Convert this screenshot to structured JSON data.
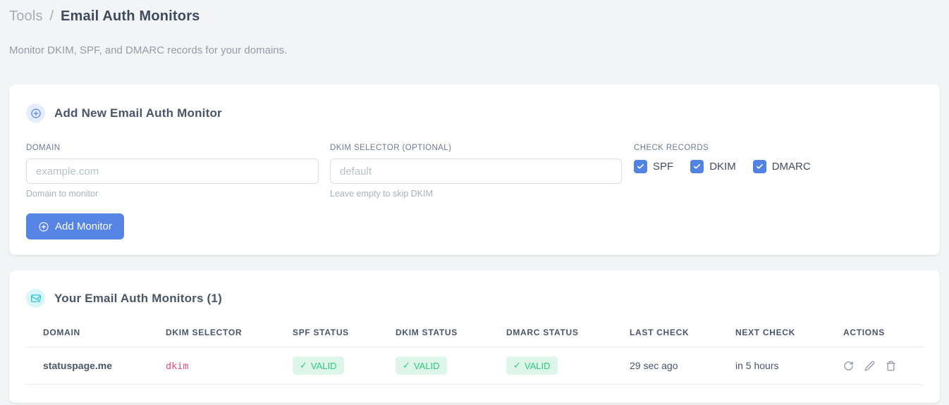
{
  "header": {
    "breadcrumb": {
      "section": "Tools",
      "separator": "/",
      "current": "Email Auth Monitors"
    },
    "subtitle": "Monitor DKIM, SPF, and DMARC records for your domains."
  },
  "add_card": {
    "title": "Add New Email Auth Monitor",
    "fields": {
      "domain": {
        "label": "DOMAIN",
        "placeholder": "example.com",
        "value": "",
        "helper": "Domain to monitor"
      },
      "dkim_selector": {
        "label": "DKIM SELECTOR (OPTIONAL)",
        "placeholder": "default",
        "value": "",
        "helper": "Leave empty to skip DKIM"
      }
    },
    "check_records": {
      "label": "CHECK RECORDS",
      "options": [
        {
          "label": "SPF",
          "checked": true
        },
        {
          "label": "DKIM",
          "checked": true
        },
        {
          "label": "DMARC",
          "checked": true
        }
      ]
    },
    "submit_button": "Add Monitor"
  },
  "monitors_card": {
    "title": "Your Email Auth Monitors (1)",
    "table": {
      "headers": [
        "DOMAIN",
        "DKIM SELECTOR",
        "SPF STATUS",
        "DKIM STATUS",
        "DMARC STATUS",
        "LAST CHECK",
        "NEXT CHECK",
        "ACTIONS"
      ],
      "rows": [
        {
          "domain": "statuspage.me",
          "dkim_selector": "dkim",
          "spf_status": "VALID",
          "dkim_status": "VALID",
          "dmarc_status": "VALID",
          "last_check": "29 sec ago",
          "next_check": "in 5 hours",
          "actions": [
            "refresh",
            "edit",
            "delete"
          ]
        }
      ]
    }
  },
  "icons": {
    "check_glyph": "✓"
  },
  "colors": {
    "accent_blue": "#5584e4",
    "accent_cyan": "#27c3d4",
    "valid_green": "#2bc97e",
    "valid_bg": "#ddf6e9",
    "selector_pink": "#ea4a7c",
    "page_bg": "#f3f4f6"
  }
}
